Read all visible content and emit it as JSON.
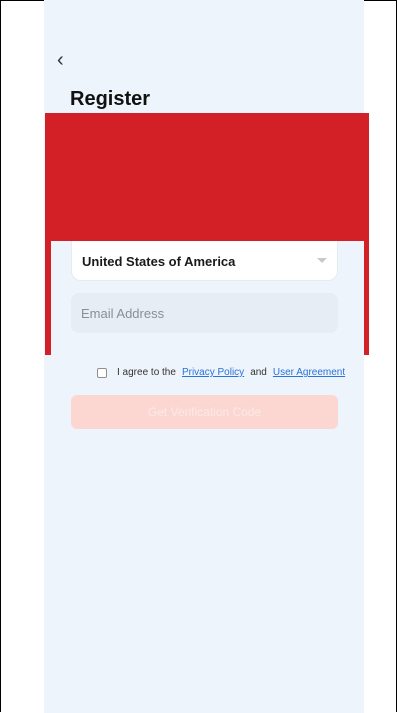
{
  "header": {
    "title": "Register"
  },
  "form": {
    "country_value": "United States of America",
    "email_placeholder": "Email Address",
    "agreement_prefix": "I agree to the",
    "privacy_link": "Privacy Policy",
    "agreement_join": "and",
    "user_agreement_link": "User Agreement",
    "verify_button": "Get Verification Code"
  },
  "icons": {
    "back": "chevron-left-icon",
    "dropdown": "caret-down-icon"
  },
  "colors": {
    "highlight": "#d32026",
    "background": "#eef4fb",
    "button": "#fcd7d2",
    "link": "#2a73d9"
  }
}
